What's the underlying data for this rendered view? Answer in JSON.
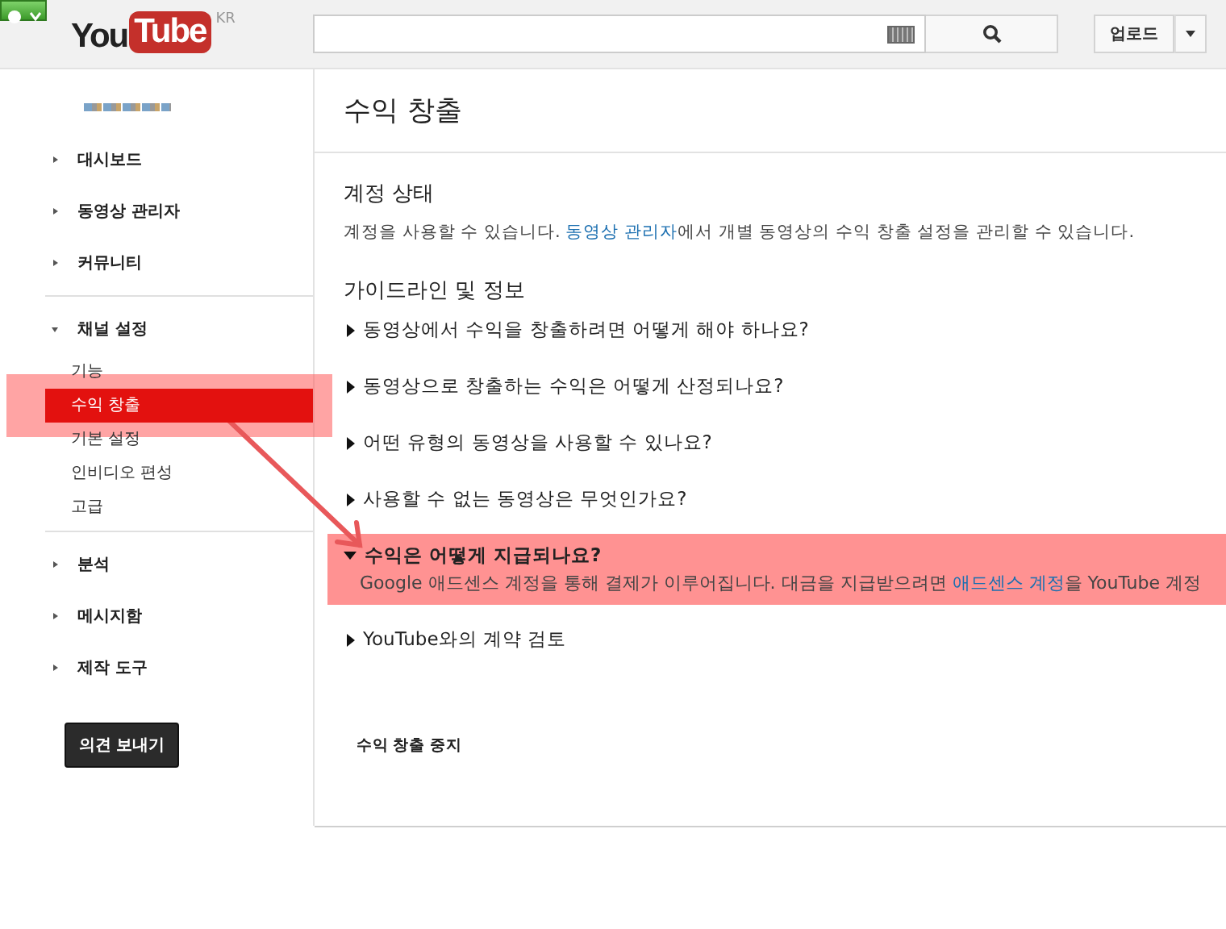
{
  "header": {
    "logo": {
      "you": "You",
      "tube": "Tube",
      "region": "KR"
    },
    "upload_button": "업로드"
  },
  "sidebar": {
    "sections": [
      {
        "items": [
          {
            "label": "대시보드",
            "expanded": false
          },
          {
            "label": "동영상 관리자",
            "expanded": false
          },
          {
            "label": "커뮤니티",
            "expanded": false
          }
        ]
      },
      {
        "items": [
          {
            "label": "채널 설정",
            "expanded": true,
            "children": [
              {
                "label": "기능",
                "selected": false,
                "highlighted": false
              },
              {
                "label": "수익 창출",
                "selected": true,
                "highlighted": true
              },
              {
                "label": "기본 설정",
                "selected": false,
                "highlighted": false
              },
              {
                "label": "인비디오 편성",
                "selected": false,
                "highlighted": false
              },
              {
                "label": "고급",
                "selected": false,
                "highlighted": false
              }
            ]
          }
        ]
      },
      {
        "items": [
          {
            "label": "분석",
            "expanded": false
          },
          {
            "label": "메시지함",
            "expanded": false
          },
          {
            "label": "제작 도구",
            "expanded": false
          }
        ]
      }
    ],
    "feedback_button": "의견 보내기"
  },
  "main": {
    "title": "수익 창출",
    "status": {
      "heading": "계정 상태",
      "text_before": "계정을 사용할 수 있습니다. ",
      "link": "동영상 관리자",
      "text_after": "에서 개별 동영상의 수익 창출 설정을 관리할 수 있습니다."
    },
    "guidelines": {
      "heading": "가이드라인 및 정보",
      "items": [
        {
          "question": "동영상에서 수익을 창출하려면 어떻게 해야 하나요?",
          "expanded": false,
          "highlighted": false
        },
        {
          "question": "동영상으로 창출하는 수익은 어떻게 산정되나요?",
          "expanded": false,
          "highlighted": false
        },
        {
          "question": "어떤 유형의 동영상을 사용할 수 있나요?",
          "expanded": false,
          "highlighted": false
        },
        {
          "question": "사용할 수 없는 동영상은 무엇인가요?",
          "expanded": false,
          "highlighted": false
        },
        {
          "question": "수익은 어떻게 지급되나요?",
          "expanded": true,
          "highlighted": true,
          "answer": {
            "text_before": "Google 애드센스 계정을 통해 결제가 이루어집니다. 대금을 지급받으려면 ",
            "link": "애드센스 계정",
            "text_after": "을 YouTube 계정"
          }
        },
        {
          "question": "YouTube와의 계약 검토",
          "expanded": false,
          "highlighted": false
        }
      ]
    },
    "stop_link": "수익 창출 중지"
  }
}
